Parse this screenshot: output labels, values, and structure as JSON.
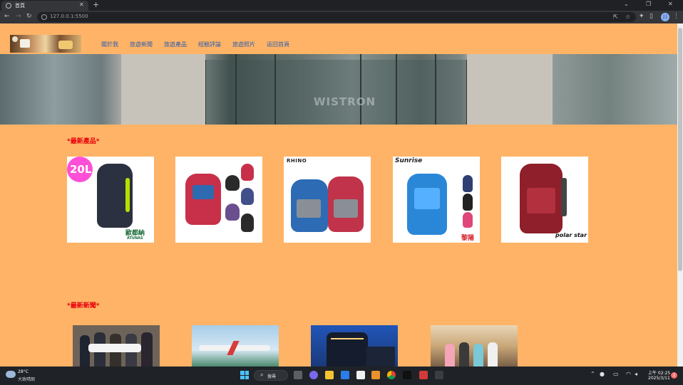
{
  "browser": {
    "tab_title": "首頁",
    "tab_close": "✕",
    "new_tab": "+",
    "url": "127.0.0.1:5500",
    "win_minimize": "⌄",
    "win_restore": "❐",
    "win_close": "✕",
    "profile_initials": "J J"
  },
  "site": {
    "nav": [
      {
        "label": "關於我"
      },
      {
        "label": "旅遊新聞"
      },
      {
        "label": "旅遊產品"
      },
      {
        "label": "經驗評論"
      },
      {
        "label": "旅遊照片"
      },
      {
        "label": "返回首頁"
      }
    ],
    "banner_sign": "WISTRON",
    "sections": {
      "products_title": "*最新產品*",
      "news_title": "*最新新聞*"
    },
    "products": [
      {
        "tag": "20L",
        "brand": "歐都納",
        "brand_sub": "ATUNAS",
        "bag_color": "#2b3140",
        "accent": "#b7e000"
      },
      {
        "brand": "",
        "bag_color": "#c8304a",
        "accent": "#2d6ab0"
      },
      {
        "brand": "RHINO",
        "bag_color": "#2d6bb5",
        "accent": "#c0334a"
      },
      {
        "brand": "Sunrise",
        "brand_sub": "黎陽",
        "bag_color": "#2a87d8",
        "accent": "#e0467a"
      },
      {
        "brand": "polar star",
        "bag_color": "#8e1f2b",
        "accent": "#444444"
      }
    ],
    "news": [
      {
        "bg": "#6d6358"
      },
      {
        "bg": "#a8cde8"
      },
      {
        "bg": "#1f3f8a"
      },
      {
        "bg": "#c9a878"
      }
    ]
  },
  "taskbar": {
    "weather_temp": "28°C",
    "weather_desc": "大致晴朗",
    "search_label": "搜尋",
    "time": "上午 02:25",
    "date": "2025/3/11",
    "notification_count": "2"
  }
}
